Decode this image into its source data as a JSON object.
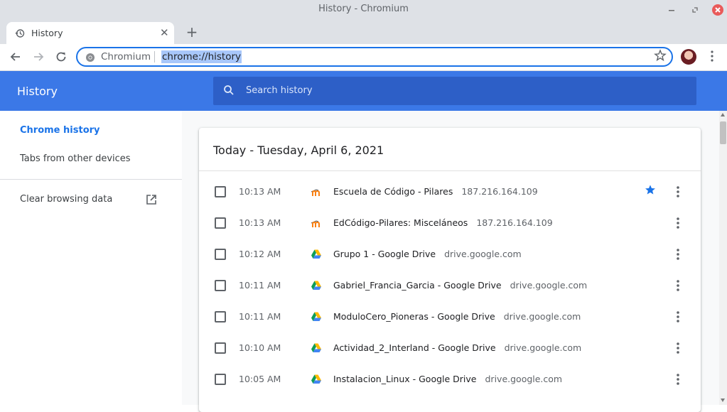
{
  "window": {
    "title": "History - Chromium",
    "minimize_icon": "minimize-icon",
    "maximize_icon": "restore-icon",
    "close_icon": "close-icon"
  },
  "tab": {
    "title": "History",
    "icon": "history-icon",
    "close_glyph": "✕",
    "new_tab_glyph": "+"
  },
  "toolbar": {
    "site_name": "Chromium",
    "url": "chrome://history",
    "bookmark_icon": "star-outline-icon"
  },
  "header": {
    "title": "History",
    "search_placeholder": "Search history"
  },
  "sidebar": {
    "items": [
      {
        "label": "Chrome history",
        "active": true
      },
      {
        "label": "Tabs from other devices",
        "active": false
      },
      {
        "label": "Clear browsing data",
        "active": false,
        "icon": "open-in-new-icon"
      }
    ]
  },
  "history": {
    "day_heading": "Today - Tuesday, April 6, 2021",
    "entries": [
      {
        "time": "10:13 AM",
        "title": "Escuela de Código - Pilares",
        "domain": "187.216.164.109",
        "favicon": "moodle-icon",
        "starred": true
      },
      {
        "time": "10:13 AM",
        "title": "EdCódigo-Pilares: Misceláneos",
        "domain": "187.216.164.109",
        "favicon": "moodle-icon",
        "starred": false
      },
      {
        "time": "10:12 AM",
        "title": "Grupo 1 - Google Drive",
        "domain": "drive.google.com",
        "favicon": "google-drive-icon",
        "starred": false
      },
      {
        "time": "10:11 AM",
        "title": "Gabriel_Francia_Garcia - Google Drive",
        "domain": "drive.google.com",
        "favicon": "google-drive-icon",
        "starred": false
      },
      {
        "time": "10:11 AM",
        "title": "ModuloCero_Pioneras - Google Drive",
        "domain": "drive.google.com",
        "favicon": "google-drive-icon",
        "starred": false
      },
      {
        "time": "10:10 AM",
        "title": "Actividad_2_Interland - Google Drive",
        "domain": "drive.google.com",
        "favicon": "google-drive-icon",
        "starred": false
      },
      {
        "time": "10:05 AM",
        "title": "Instalacion_Linux - Google Drive",
        "domain": "drive.google.com",
        "favicon": "google-drive-icon",
        "starred": false
      }
    ]
  },
  "colors": {
    "header_blue": "#3b78e7",
    "search_blue": "#2d5fc7",
    "accent": "#1a73e8"
  }
}
